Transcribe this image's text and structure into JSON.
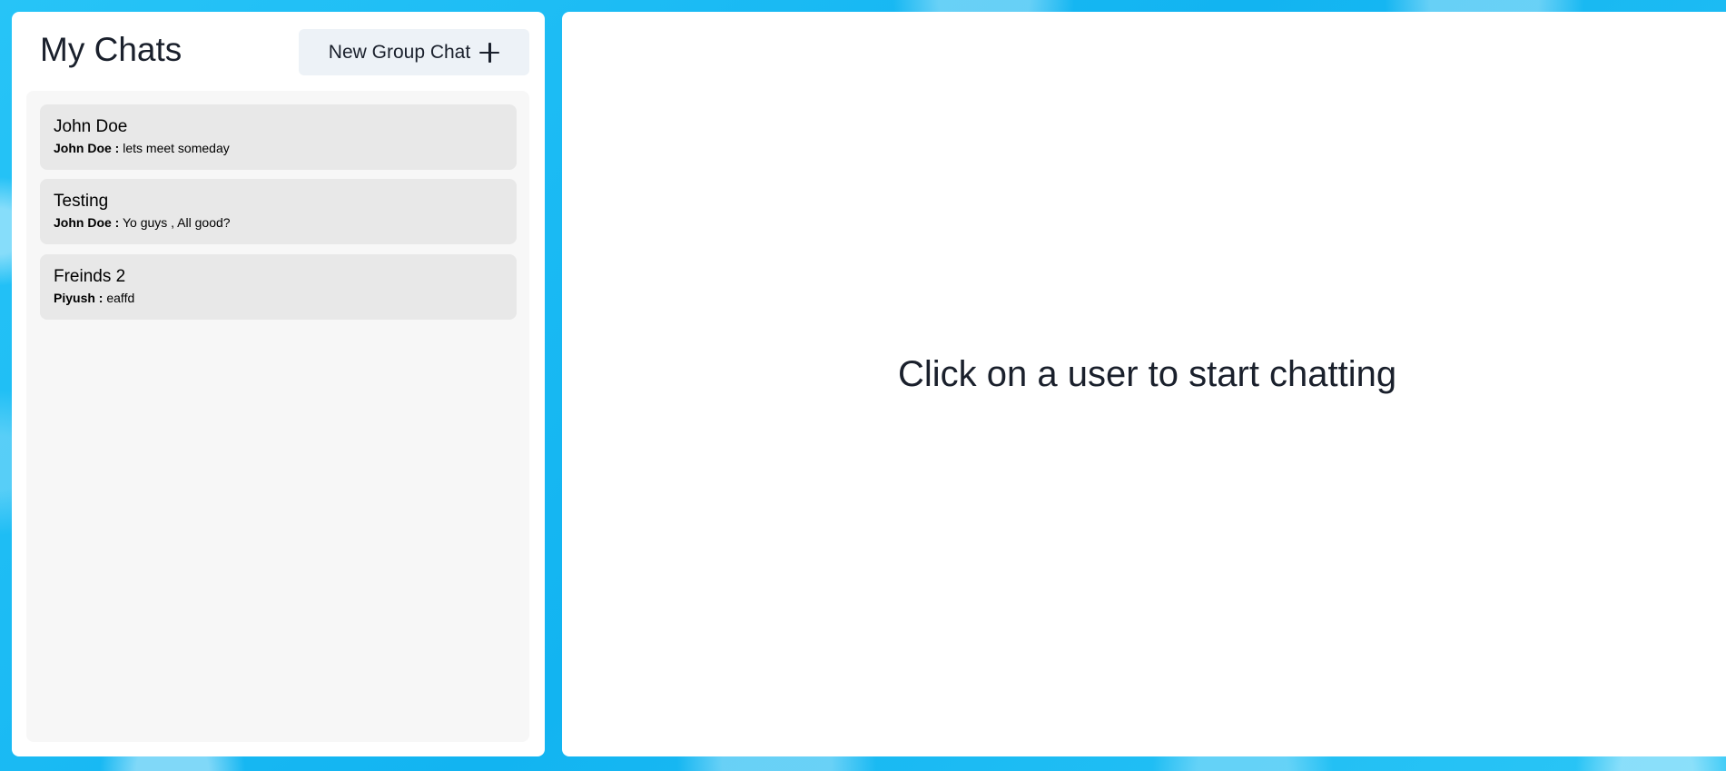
{
  "sidebar": {
    "title": "My Chats",
    "new_group_label": "New Group Chat",
    "chats": [
      {
        "name": "John Doe",
        "sender": "John Doe :",
        "message": "lets meet someday"
      },
      {
        "name": "Testing",
        "sender": "John Doe :",
        "message": "Yo guys , All good?"
      },
      {
        "name": "Freinds 2",
        "sender": "Piyush :",
        "message": "eaffd"
      }
    ]
  },
  "main": {
    "placeholder": "Click on a user to start chatting"
  },
  "icons": {
    "new_group": "plus-icon"
  },
  "colors": {
    "background": "#1bbdf5",
    "panel": "#ffffff",
    "chat_list_bg": "#f7f7f7",
    "chat_item_bg": "#e8e8e8",
    "button_bg": "#edf2f7",
    "text": "#1a202c"
  }
}
